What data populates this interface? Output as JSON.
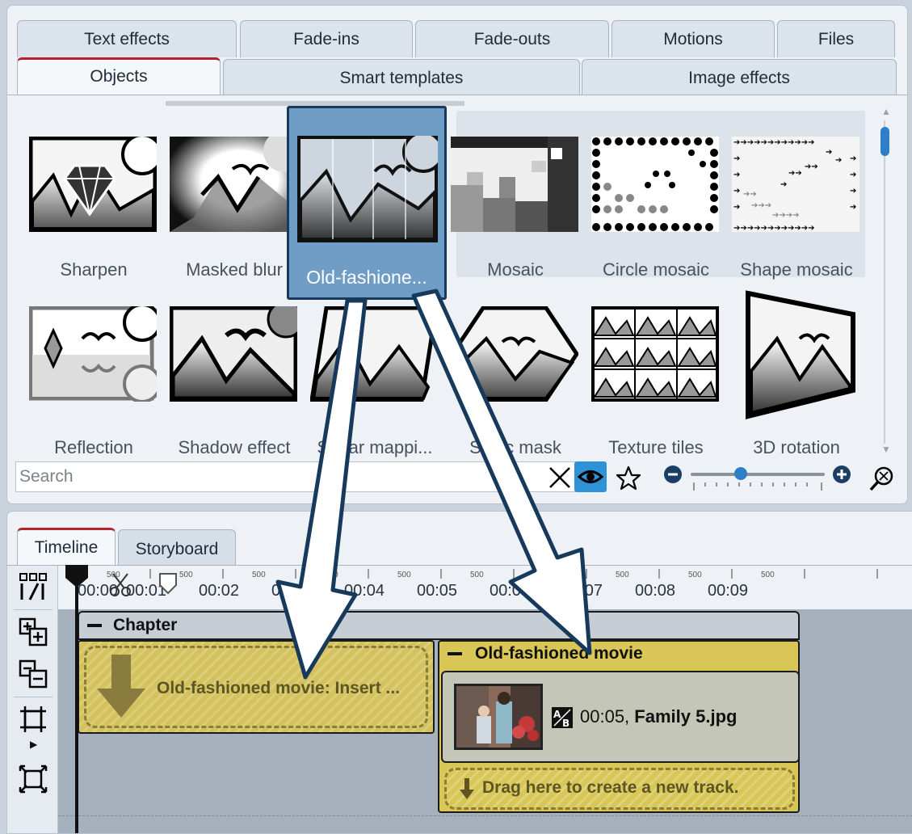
{
  "tabs_row1": [
    {
      "label": "Text effects",
      "name": "tab-text-effects"
    },
    {
      "label": "Fade-ins",
      "name": "tab-fade-ins"
    },
    {
      "label": "Fade-outs",
      "name": "tab-fade-outs"
    },
    {
      "label": "Motions",
      "name": "tab-motions"
    },
    {
      "label": "Files",
      "name": "tab-files"
    }
  ],
  "tabs_row2": [
    {
      "label": "Objects",
      "name": "tab-objects",
      "active": true
    },
    {
      "label": "Smart templates",
      "name": "tab-smart-templates"
    },
    {
      "label": "Image effects",
      "name": "tab-image-effects"
    }
  ],
  "effects": [
    "Sharpen",
    "Masked blur",
    "Old-fashioned movie",
    "Mosaic",
    "Circle mosaic",
    "Shape mosaic",
    "Reflection",
    "Shadow effect",
    "Shear mappi...",
    "Static mask",
    "Texture tiles",
    "3D rotation"
  ],
  "search": {
    "placeholder": "Search",
    "value": ""
  },
  "icons": {
    "clear": "close-icon",
    "visibility": "eye-icon",
    "favorite": "star-icon",
    "zoom_out": "minus-circle-icon",
    "zoom_in": "plus-circle-icon",
    "fit": "zoom-fit-icon"
  },
  "zoom_level": 0.33,
  "bottom_tabs": [
    {
      "label": "Timeline",
      "name": "tab-timeline",
      "active": true
    },
    {
      "label": "Storyboard",
      "name": "tab-storyboard"
    }
  ],
  "ruler": {
    "ticks": [
      "00:00",
      "00:01",
      "00:02",
      "00:03",
      "00:04",
      "00:05",
      "00:06",
      "00:07",
      "00:08",
      "00:09"
    ],
    "sub_label": "500"
  },
  "timeline": {
    "chapter_label": "Chapter",
    "drop_zone_label": "Old-fashioned movie: Insert ...",
    "effect_title": "Old-fashioned movie",
    "clip_time": "00:05,",
    "clip_file": "Family 5.jpg",
    "new_track_label": "Drag here to create a new track."
  },
  "drag_tile": {
    "label": "Old-fashione..."
  },
  "colors": {
    "accent": "#2e92d6",
    "tab_active_border": "#b3242a",
    "track_bg": "#a6b1bd",
    "effect_yellow": "#d8c657",
    "drag_tile": "#6f9dc6"
  }
}
